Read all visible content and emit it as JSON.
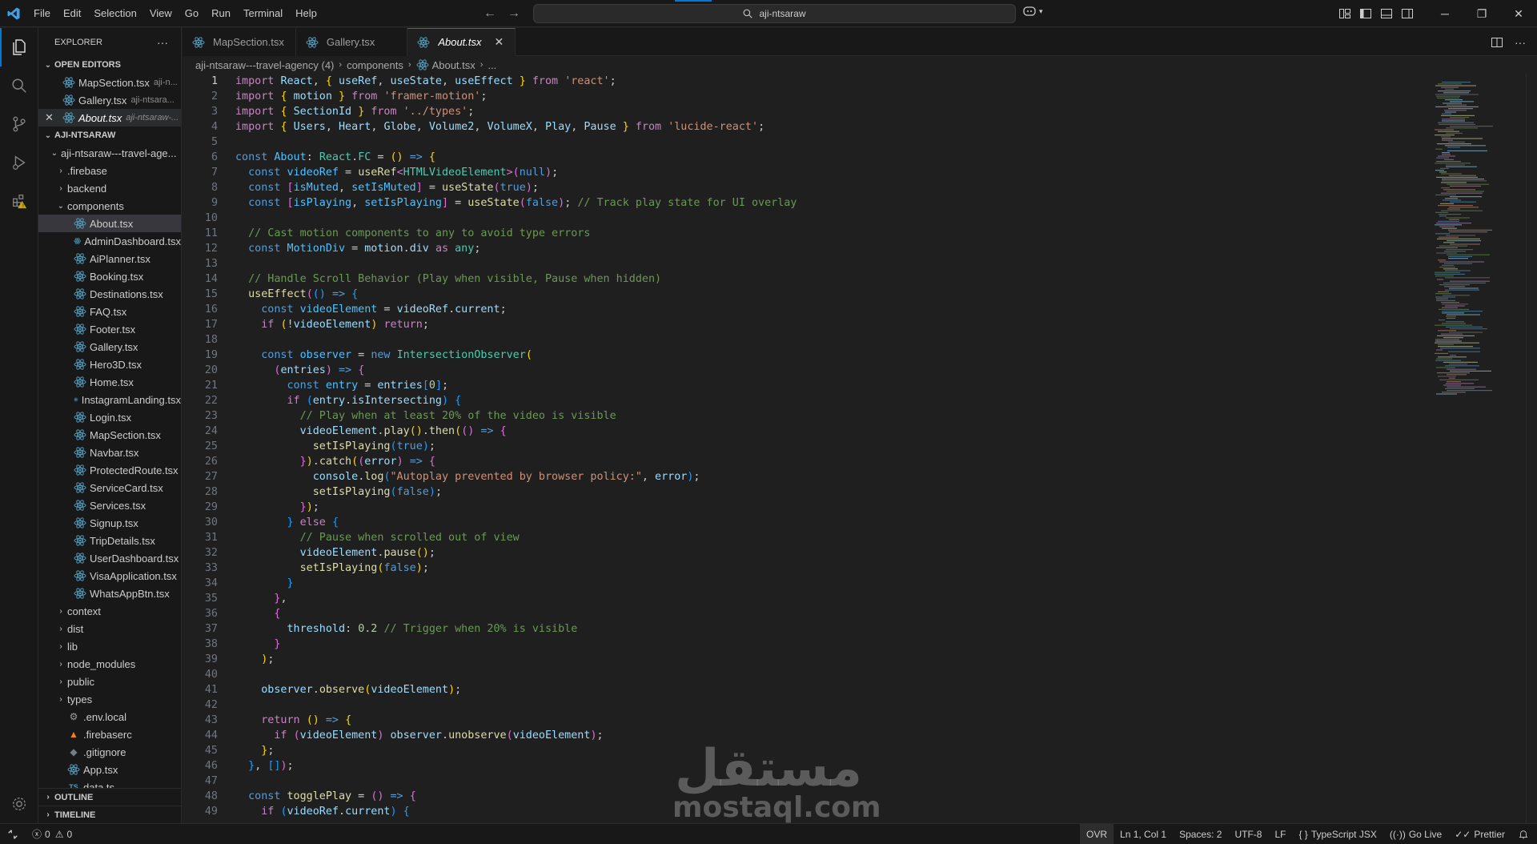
{
  "titlebar": {
    "menu": [
      "File",
      "Edit",
      "Selection",
      "View",
      "Go",
      "Run",
      "Terminal",
      "Help"
    ],
    "search_text": "aji-ntsaraw"
  },
  "sidebar": {
    "header": "EXPLORER",
    "open_editors_title": "OPEN EDITORS",
    "open_editors": [
      {
        "name": "MapSection.tsx",
        "desc": "aji-n..."
      },
      {
        "name": "Gallery.tsx",
        "desc": "aji-ntsara..."
      },
      {
        "name": "About.tsx",
        "desc": "aji-ntsaraw-..."
      }
    ],
    "project_title": "AJI-NTSARAW",
    "root_folder": "aji-ntsaraw---travel-age...",
    "folders_top": [
      ".firebase",
      "backend"
    ],
    "components_folder": "components",
    "components": [
      "About.tsx",
      "AdminDashboard.tsx",
      "AiPlanner.tsx",
      "Booking.tsx",
      "Destinations.tsx",
      "FAQ.tsx",
      "Footer.tsx",
      "Gallery.tsx",
      "Hero3D.tsx",
      "Home.tsx",
      "InstagramLanding.tsx",
      "Login.tsx",
      "MapSection.tsx",
      "Navbar.tsx",
      "ProtectedRoute.tsx",
      "ServiceCard.tsx",
      "Services.tsx",
      "Signup.tsx",
      "TripDetails.tsx",
      "UserDashboard.tsx",
      "VisaApplication.tsx",
      "WhatsAppBtn.tsx"
    ],
    "folders_bottom": [
      "context",
      "dist",
      "lib",
      "node_modules",
      "public",
      "types"
    ],
    "root_files": [
      ".env.local",
      ".firebaserc",
      ".gitignore",
      "App.tsx",
      "data.ts"
    ],
    "outline_title": "OUTLINE",
    "timeline_title": "TIMELINE"
  },
  "tabs": [
    {
      "label": "MapSection.tsx"
    },
    {
      "label": "Gallery.tsx"
    },
    {
      "label": "About.tsx"
    }
  ],
  "breadcrumb": [
    "aji-ntsaraw---travel-agency (4)",
    "components",
    "About.tsx",
    "..."
  ],
  "code_lines": [
    "1",
    "2",
    "3",
    "4",
    "5",
    "6",
    "7",
    "8",
    "9",
    "10",
    "11",
    "12",
    "13",
    "14",
    "15",
    "16",
    "17",
    "18",
    "19",
    "20",
    "21",
    "22",
    "23",
    "24",
    "25",
    "26",
    "27",
    "28",
    "29",
    "30",
    "31",
    "32",
    "33",
    "34",
    "35",
    "36",
    "37",
    "38",
    "39",
    "40",
    "41",
    "42",
    "43",
    "44",
    "45",
    "46",
    "47",
    "48",
    "49"
  ],
  "watermark": {
    "arabic": "مستقل",
    "latin": "mostaql.com"
  },
  "statusbar": {
    "errors": "0",
    "warnings": "0",
    "ovr": "OVR",
    "position": "Ln 1, Col 1",
    "spaces": "Spaces: 2",
    "encoding": "UTF-8",
    "eol": "LF",
    "language": "TypeScript JSX",
    "golive": "Go Live",
    "prettier": "Prettier"
  },
  "colors": {
    "accent": "#0078d4",
    "editor_bg": "#1f1f1f",
    "chrome_bg": "#181818",
    "tsx_icon": "#519aba"
  }
}
